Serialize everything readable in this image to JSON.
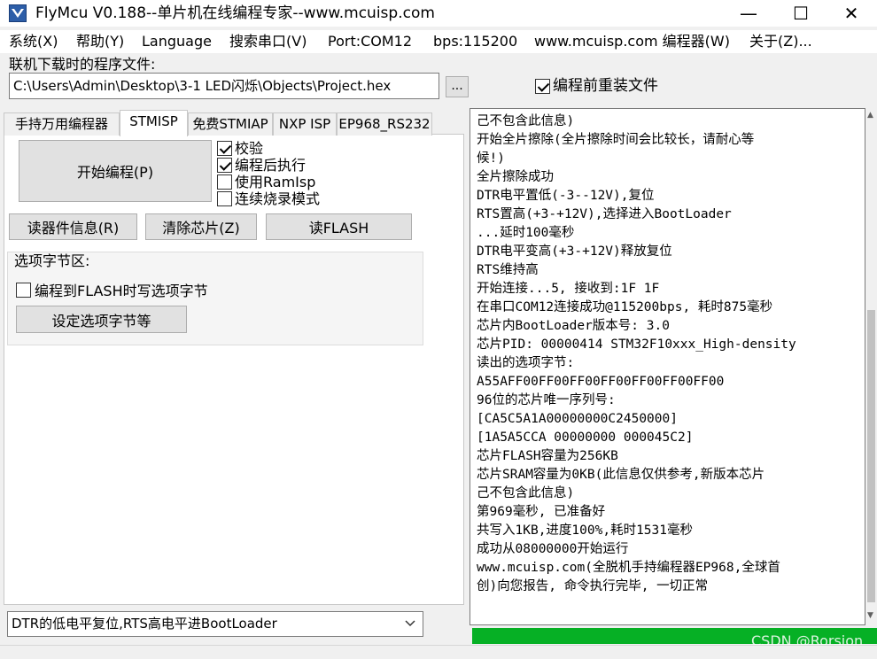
{
  "window": {
    "title": "FlyMcu V0.188--单片机在线编程专家--www.mcuisp.com",
    "min_glyph": "—",
    "max_glyph": "☐",
    "close_glyph": "✕"
  },
  "menu": [
    "系统(X)",
    "帮助(Y)",
    "Language",
    "搜索串口(V)",
    "Port:COM12",
    "bps:115200",
    "www.mcuisp.com 编程器(W)",
    "关于(Z)..."
  ],
  "file": {
    "label": "联机下载时的程序文件:",
    "path": "C:\\Users\\Admin\\Desktop\\3-1 LED闪烁\\Objects\\Project.hex",
    "browse_label": "...",
    "reload_label": "编程前重装文件",
    "reload_checked": true
  },
  "tabs": [
    "手持万用编程器",
    "STMISP",
    "免费STMIAP",
    "NXP ISP",
    "EP968_RS232"
  ],
  "active_tab": "STMISP",
  "stmisp": {
    "start_button": "开始编程(P)",
    "options": [
      {
        "label": "校验",
        "checked": true
      },
      {
        "label": "编程后执行",
        "checked": true
      },
      {
        "label": "使用RamIsp",
        "checked": false
      },
      {
        "label": "连续烧录模式",
        "checked": false
      }
    ],
    "read_info_button": "读器件信息(R)",
    "erase_button": "清除芯片(Z)",
    "read_flash_button": "读FLASH",
    "option_group_label": "选项字节区:",
    "write_option_label": "编程到FLASH时写选项字节",
    "write_option_checked": false,
    "set_option_button": "设定选项字节等"
  },
  "dtr_mode": "DTR的低电平复位,RTS高电平进BootLoader",
  "log_lines": [
    "己不包含此信息)",
    "开始全片擦除(全片擦除时间会比较长，请耐心等",
    "候!)",
    "全片擦除成功",
    "DTR电平置低(-3--12V),复位",
    "RTS置高(+3-+12V),选择进入BootLoader",
    "...延时100毫秒",
    "DTR电平变高(+3-+12V)释放复位",
    "RTS维持高",
    "开始连接...5, 接收到:1F 1F",
    "在串口COM12连接成功@115200bps, 耗时875毫秒",
    "芯片内BootLoader版本号: 3.0",
    "芯片PID: 00000414  STM32F10xxx_High-density",
    "读出的选项字节:",
    "A55AFF00FF00FF00FF00FF00FF00FF00",
    "96位的芯片唯一序列号:",
    "[CA5C5A1A00000000C2450000]",
    "[1A5A5CCA 00000000 000045C2]",
    "芯片FLASH容量为256KB",
    "芯片SRAM容量为0KB(此信息仅供参考,新版本芯片",
    "己不包含此信息)",
    "第969毫秒, 已准备好",
    "共写入1KB,进度100%,耗时1531毫秒",
    "成功从08000000开始运行",
    "www.mcuisp.com(全脱机手持编程器EP968,全球首",
    "创)向您报告, 命令执行完毕, 一切正常"
  ],
  "progress": 1.0,
  "progress_color": "#06b025",
  "watermark": "CSDN @Rorsion"
}
